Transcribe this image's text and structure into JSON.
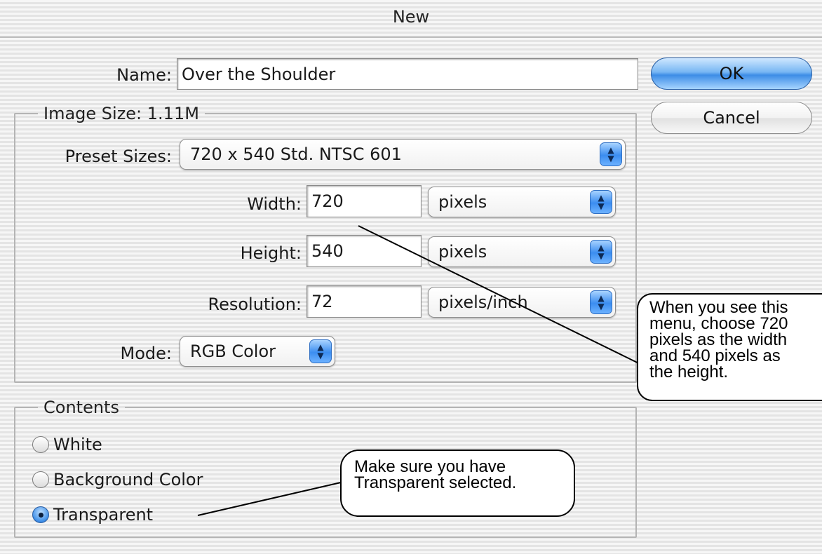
{
  "dialog": {
    "title": "New"
  },
  "name": {
    "label": "Name:",
    "value": "Over the Shoulder"
  },
  "buttons": {
    "ok": "OK",
    "cancel": "Cancel"
  },
  "image_size": {
    "legend": "Image Size: 1.11M",
    "preset": {
      "label": "Preset Sizes:",
      "value": "720 x 540 Std. NTSC 601"
    },
    "width": {
      "label": "Width:",
      "value": "720",
      "unit": "pixels"
    },
    "height": {
      "label": "Height:",
      "value": "540",
      "unit": "pixels"
    },
    "resolution": {
      "label": "Resolution:",
      "value": "72",
      "unit": "pixels/inch"
    },
    "mode": {
      "label": "Mode:",
      "value": "RGB Color"
    }
  },
  "contents": {
    "legend": "Contents",
    "options": [
      {
        "label": "White",
        "selected": false
      },
      {
        "label": "Background Color",
        "selected": false
      },
      {
        "label": "Transparent",
        "selected": true
      }
    ]
  },
  "callouts": {
    "size": [
      "When you see this",
      "menu, choose 720",
      "pixels as the width",
      "and 540 pixels as",
      "the height."
    ],
    "transparent": [
      "Make sure you have",
      "Transparent selected."
    ]
  },
  "colors": {
    "accent": "#3d8de6",
    "callout_border": "#000000"
  }
}
